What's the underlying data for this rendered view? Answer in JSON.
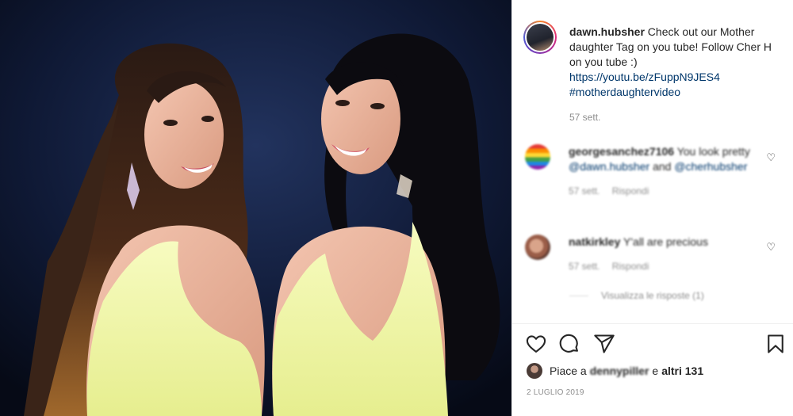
{
  "post": {
    "author": "dawn.hubsher",
    "caption": "Check out our Mother daughter Tag on you tube! Follow Cher H on you tube :)",
    "link": "https://youtu.be/zFuppN9JES4",
    "hashtag": "#motherdaughtervideo",
    "time": "57 sett."
  },
  "comments": [
    {
      "user": "georgesanchez7106",
      "text_before": "You look pretty",
      "mention1": "@dawn.hubsher",
      "text_mid": "and",
      "mention2": "@cherhubsher",
      "time": "57 sett.",
      "reply_label": "Rispondi",
      "avatar": "rainbow-avatar"
    },
    {
      "user": "natkirkley",
      "text": "Y'all are precious",
      "time": "57 sett.",
      "reply_label": "Rispondi",
      "view_replies": "Visualizza le risposte (1)",
      "avatar": "face-avatar"
    }
  ],
  "likes": {
    "prefix": "Piace a",
    "user": "dennypiller",
    "suffix_and": "e",
    "others": "altri 131"
  },
  "date": "2 LUGLIO 2019",
  "icons": {
    "like": "heart-icon",
    "comment": "comment-bubble-icon",
    "share": "paper-plane-icon",
    "save": "bookmark-icon"
  },
  "colors": {
    "link": "#00376b",
    "muted": "#8e8e8e",
    "dress": "#eff5a6",
    "background": "#101a36"
  }
}
